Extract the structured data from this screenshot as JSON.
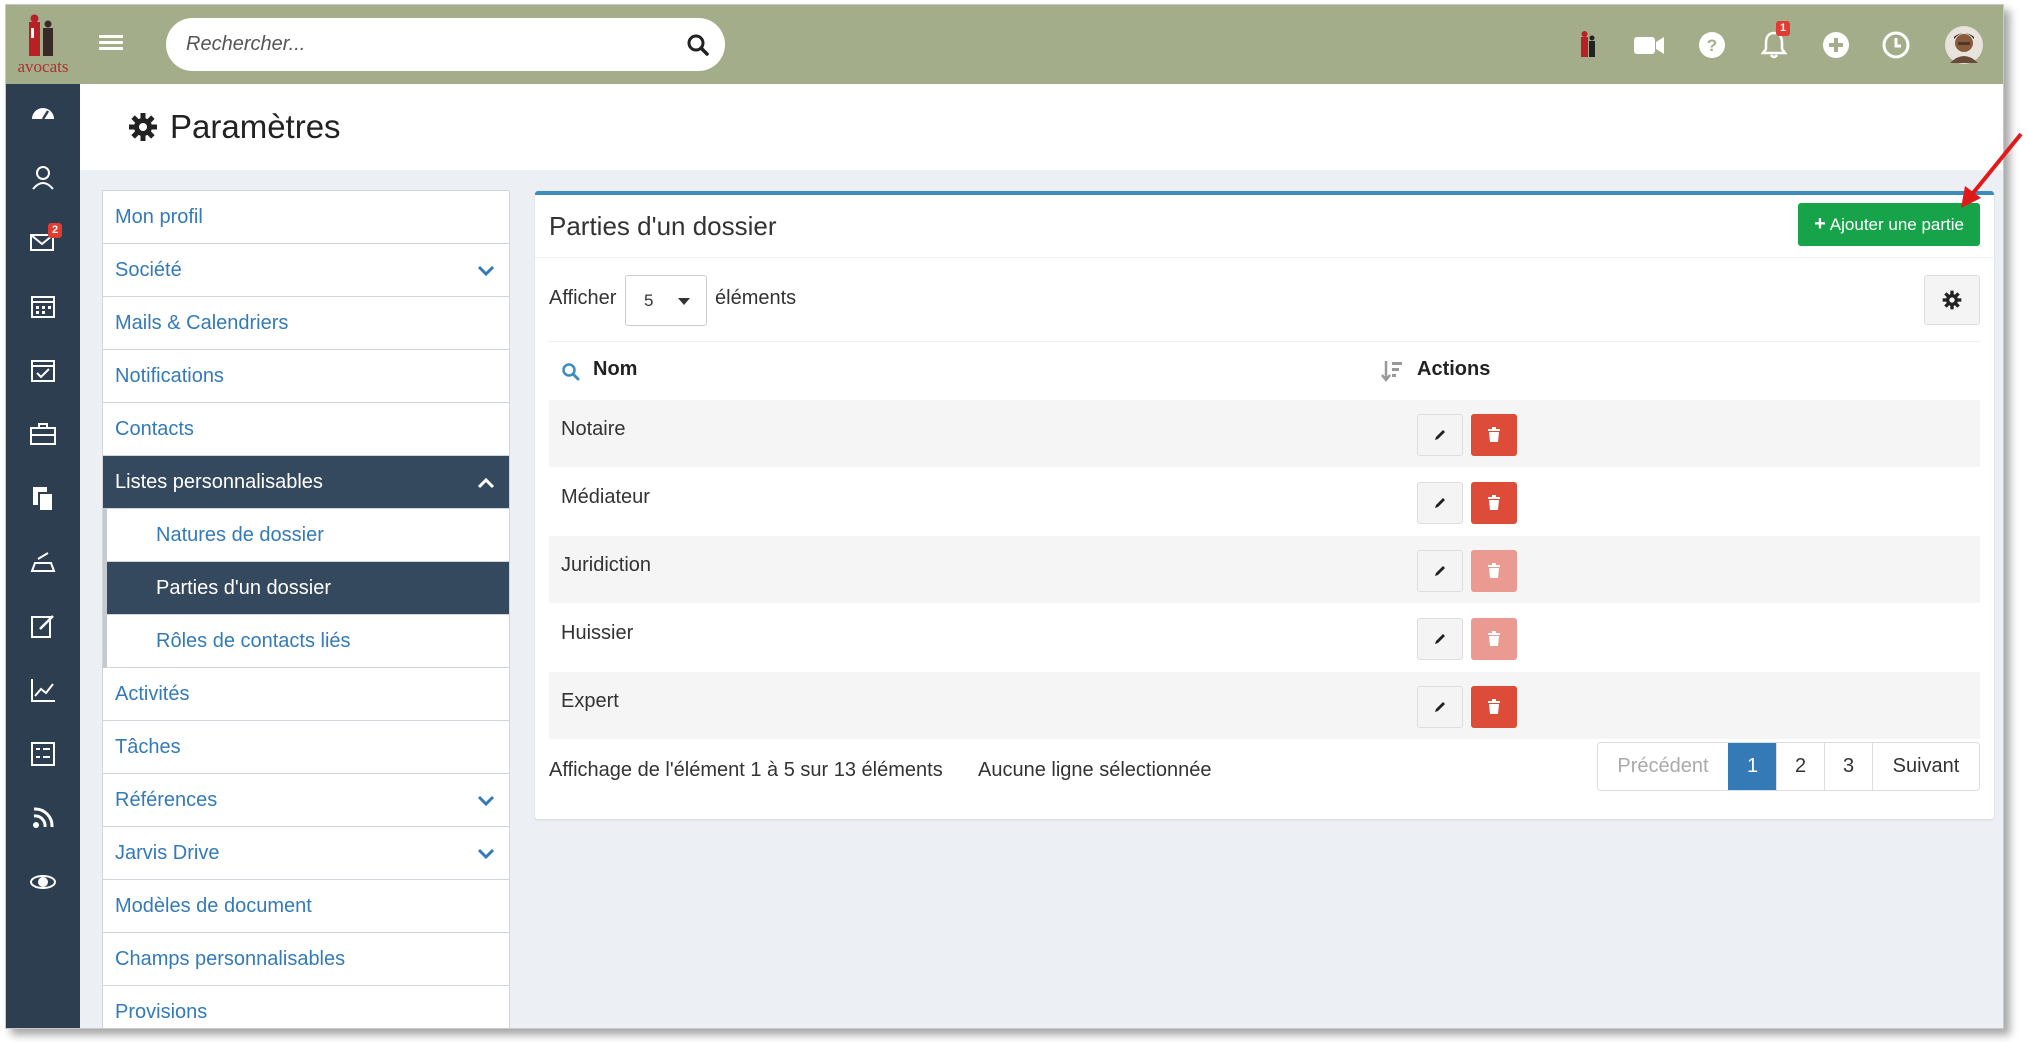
{
  "topbar": {
    "logo_text": "avocats",
    "search_placeholder": "Rechercher...",
    "notification_count": "1"
  },
  "rail": {
    "mail_badge": "2"
  },
  "page": {
    "title": "Paramètres"
  },
  "menu": {
    "items": [
      {
        "label": "Mon profil"
      },
      {
        "label": "Société"
      },
      {
        "label": "Mails & Calendriers"
      },
      {
        "label": "Notifications"
      },
      {
        "label": "Contacts"
      },
      {
        "label": "Listes personnalisables"
      },
      {
        "label": "Natures de dossier"
      },
      {
        "label": "Parties d'un dossier"
      },
      {
        "label": "Rôles de contacts liés"
      },
      {
        "label": "Activités"
      },
      {
        "label": "Tâches"
      },
      {
        "label": "Références"
      },
      {
        "label": "Jarvis Drive"
      },
      {
        "label": "Modèles de document"
      },
      {
        "label": "Champs personnalisables"
      },
      {
        "label": "Provisions"
      }
    ]
  },
  "panel": {
    "title": "Parties d'un dossier",
    "add_button": "Ajouter une partie",
    "show_label": "Afficher",
    "show_value": "5",
    "show_suffix": "éléments",
    "columns": {
      "name": "Nom",
      "actions": "Actions"
    },
    "rows": [
      {
        "name": "Notaire",
        "delete_enabled": true
      },
      {
        "name": "Médiateur",
        "delete_enabled": true
      },
      {
        "name": "Juridiction",
        "delete_enabled": false
      },
      {
        "name": "Huissier",
        "delete_enabled": false
      },
      {
        "name": "Expert",
        "delete_enabled": true
      }
    ],
    "info": "Affichage de l'élément 1 à 5 sur 13 éléments",
    "selection": "Aucune ligne sélectionnée",
    "pagination": {
      "previous": "Précédent",
      "pages": [
        "1",
        "2",
        "3"
      ],
      "current": "1",
      "next": "Suivant"
    }
  },
  "colors": {
    "topbar": "#a3ad8a",
    "rail": "#2c3e50",
    "active_menu": "#35495e",
    "link": "#337ab7",
    "add_button": "#16a34a",
    "delete_button": "#dd4b39",
    "annotation_arrow": "#e0191b"
  }
}
